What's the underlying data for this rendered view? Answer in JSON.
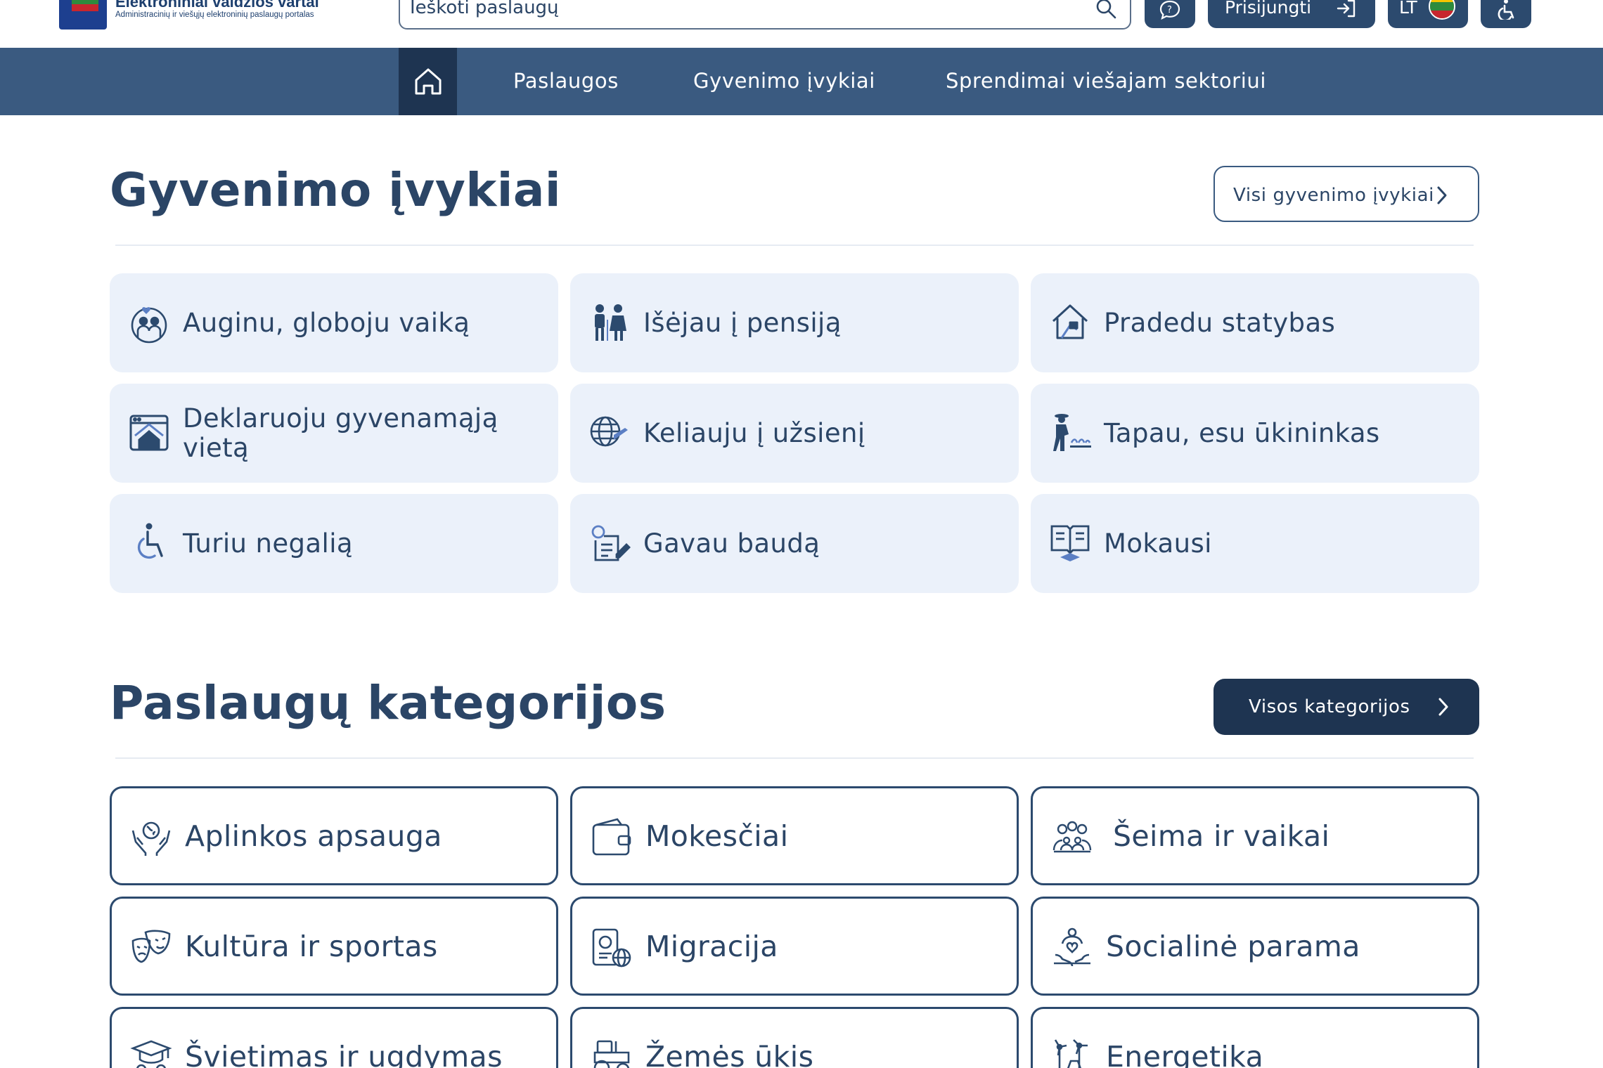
{
  "header": {
    "logo_title": "Elektroniniai valdžios vartai",
    "logo_subtitle": "Administracinių ir viešųjų elektroninių paslaugų portalas",
    "search_placeholder": "Ieškoti paslaugų",
    "login_label": "Prisijungti",
    "language_label": "LT"
  },
  "nav": {
    "items": [
      {
        "label": "Paslaugos"
      },
      {
        "label": "Gyvenimo įvykiai"
      },
      {
        "label": "Sprendimai viešajam sektoriui"
      }
    ]
  },
  "life_events": {
    "title": "Gyvenimo įvykiai",
    "button_label": "Visi gyvenimo įvykiai",
    "tiles": [
      {
        "label": "Auginu, globoju vaiką",
        "icon": "family-heart-icon"
      },
      {
        "label": "Išėjau į pensiją",
        "icon": "elderly-couple-icon"
      },
      {
        "label": "Pradedu statybas",
        "icon": "house-build-icon"
      },
      {
        "label": "Deklaruoju gyvenamąją vietą",
        "icon": "home-window-icon"
      },
      {
        "label": "Keliauju į užsienį",
        "icon": "globe-plane-icon"
      },
      {
        "label": "Tapau, esu ūkininkas",
        "icon": "farmer-icon"
      },
      {
        "label": "Turiu negalią",
        "icon": "wheelchair-icon"
      },
      {
        "label": "Gavau baudą",
        "icon": "fine-document-icon"
      },
      {
        "label": "Mokausi",
        "icon": "book-graduation-icon"
      }
    ]
  },
  "categories": {
    "title": "Paslaugų kategorijos",
    "button_label": "Visos kategorijos",
    "tiles": [
      {
        "label": "Aplinkos apsauga",
        "icon": "hands-globe-icon"
      },
      {
        "label": "Mokesčiai",
        "icon": "wallet-icon"
      },
      {
        "label": "Šeima ir vaikai",
        "icon": "family-group-icon"
      },
      {
        "label": "Kultūra ir sportas",
        "icon": "theater-masks-icon"
      },
      {
        "label": "Migracija",
        "icon": "passport-globe-icon"
      },
      {
        "label": "Socialinė parama",
        "icon": "social-support-icon"
      },
      {
        "label": "Švietimas ir ugdymas",
        "icon": "graduation-cap-icon"
      },
      {
        "label": "Žemės ūkis",
        "icon": "tractor-icon"
      },
      {
        "label": "Energetika",
        "icon": "wind-energy-icon"
      }
    ]
  },
  "colors": {
    "primary_dark": "#1e3451",
    "nav_blue": "#3a5a80",
    "text": "#2b4566",
    "tile_soft": "#ebf1fa"
  }
}
